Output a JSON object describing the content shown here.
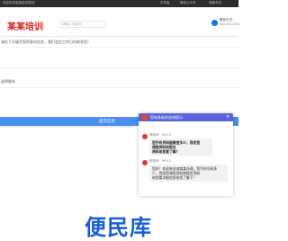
{
  "topbar": {
    "left_text": "欢迎来到某某培训官网！",
    "links": [
      "手机版",
      "微信公众号",
      "收藏本站"
    ]
  },
  "header": {
    "logo_text": "某某培训",
    "search_placeholder": "请输入关键词",
    "contact_label": "联系方式",
    "contact_number": "400-000-0000"
  },
  "form": {
    "notice": "请在下方填写您的意向信息，我们会在工作日内联系您！",
    "field_label": "选择联系",
    "submit_label": "提交信息"
  },
  "chat": {
    "title": "您有条新的咨询提示",
    "close": "×",
    "messages": [
      {
        "sender": "阿老师",
        "time": "09:11",
        "lines": [
          "您手机号码能微信多少，我发您",
          "课程资料和报名",
          "资料给您看了嘛？"
        ]
      },
      {
        "sender": "阿老师",
        "time": "09:11",
        "lines": [
          "您好！欢迎来咨询某某办理，您手机号码多",
          "少，我发您课程资料和报名资料",
          "给您看详细信息给您了解下！"
        ]
      }
    ]
  },
  "footer": {
    "watermark": "便民库"
  }
}
